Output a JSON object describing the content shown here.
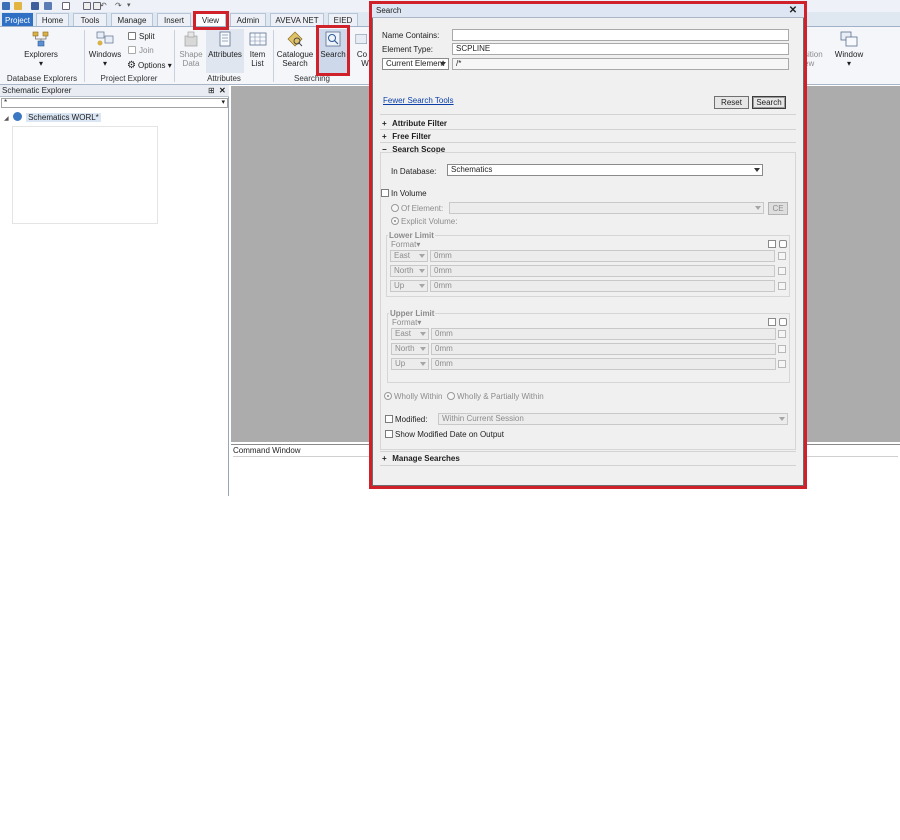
{
  "ribbon": {
    "tabs": [
      "Project",
      "Home",
      "Tools",
      "Manage",
      "Insert",
      "View",
      "Admin",
      "AVEVA NET",
      "EIED"
    ],
    "active_tab": "View",
    "buttons": {
      "explorers": "Explorers",
      "windows": "Windows",
      "split": "Split",
      "join": "Join",
      "options": "Options",
      "shape_data": [
        "Shape",
        "Data"
      ],
      "attributes": "Attributes",
      "item_list": [
        "Item",
        "List"
      ],
      "catalogue_search": [
        "Catalogue",
        "Search"
      ],
      "search": "Search",
      "partial_next": [
        "Co",
        "W"
      ],
      "partial_position": [
        "sition",
        "ew"
      ],
      "window": "Window"
    },
    "groups": {
      "database_explorers": "Database Explorers",
      "project_explorer": "Project Explorer",
      "attributes": "Attributes",
      "searching": "Searching"
    }
  },
  "explorer": {
    "title": "Schematic Explorer",
    "filter_value": "*",
    "pin_glyph": "⊞",
    "close_glyph": "✕",
    "tree_root": "Schematics WORL*"
  },
  "command_window": {
    "title": "Command Window"
  },
  "search_dialog": {
    "title": "Search",
    "close_glyph": "✕",
    "name_contains_label": "Name Contains:",
    "name_contains_value": "",
    "element_type_label": "Element Type:",
    "element_type_value": "SCPLINE",
    "scope_combo": "Current Element",
    "scope_value": "/*",
    "fewer_link": "Fewer Search Tools",
    "reset_button": "Reset",
    "search_button": "Search",
    "attribute_filter": "Attribute Filter",
    "free_filter": "Free Filter",
    "search_scope": "Search Scope",
    "collapsed_marker": "+",
    "expanded_marker": "−",
    "in_database_label": "In Database:",
    "in_database_value": "Schematics",
    "in_volume_label": "In Volume",
    "of_element_label": "Of Element:",
    "of_element_value": "",
    "ce_button": "CE",
    "explicit_volume_label": "Explicit Volume:",
    "lower_limit": {
      "title": "Lower Limit",
      "format_label": "Format▾",
      "rows": [
        {
          "axis": "East",
          "value": "0mm"
        },
        {
          "axis": "North",
          "value": "0mm"
        },
        {
          "axis": "Up",
          "value": "0mm"
        }
      ]
    },
    "upper_limit": {
      "title": "Upper Limit",
      "format_label": "Format▾",
      "rows": [
        {
          "axis": "East",
          "value": "0mm"
        },
        {
          "axis": "North",
          "value": "0mm"
        },
        {
          "axis": "Up",
          "value": "0mm"
        }
      ]
    },
    "wholly_within": "Wholly Within",
    "wholly_partially": "Wholly & Partially Within",
    "modified_label": "Modified:",
    "modified_value": "Within Current Session",
    "show_modified_label": "Show Modified Date on Output",
    "manage_searches": "Manage Searches"
  },
  "colors": {
    "highlight_red": "#d0212b",
    "project_tab_blue": "#2f6fc4",
    "workspace_grey": "#acacac",
    "link_blue": "#0b3fa8"
  }
}
